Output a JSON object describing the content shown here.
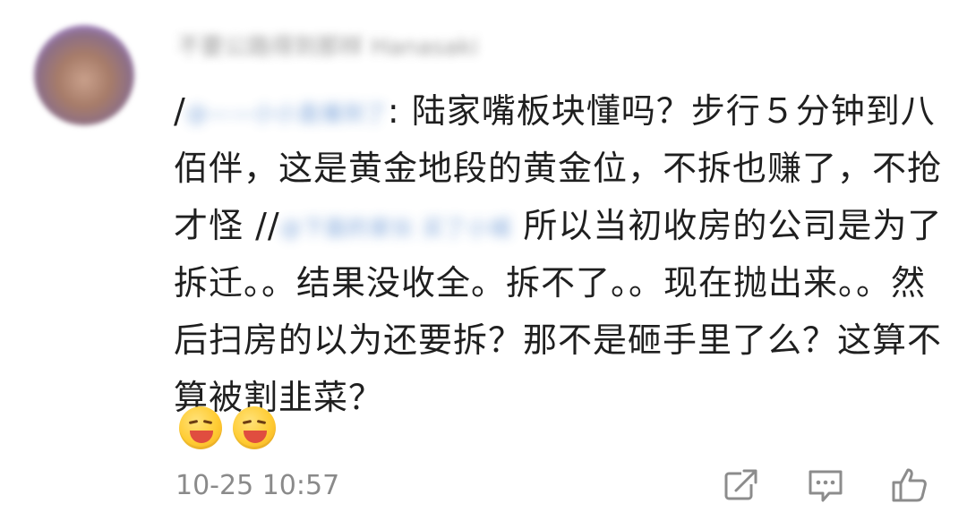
{
  "comment": {
    "username": "不要公路得到那样 Hanasaki",
    "reply_marker": "/",
    "mention1": "@——小小直播到了",
    "text_part1": ": 陆家嘴板块懂吗？步行５分钟到八佰伴，这是黄金地段的黄金位，不拆也赚了，不抢才怪 //",
    "mention2": "@下面的家伙 买了小城",
    "text_part2": " 所以当初收房的公司是为了拆迁。。结果没收全。拆不了。。现在抛出来。。然后扫房的以为还要拆？那不是砸手里了么？这算不算被割韭菜？",
    "emojis": [
      "eating-watermelon-emoji",
      "eating-watermelon-emoji"
    ],
    "timestamp": "10-25 10:57"
  },
  "actions": {
    "share_icon": "share-icon",
    "comment_icon": "comment-icon",
    "like_icon": "thumbs-up-icon"
  },
  "colors": {
    "text": "#1f1f1f",
    "meta": "#8a8a8a",
    "mention": "#6f9bd6",
    "icon": "#8c8c8c"
  }
}
